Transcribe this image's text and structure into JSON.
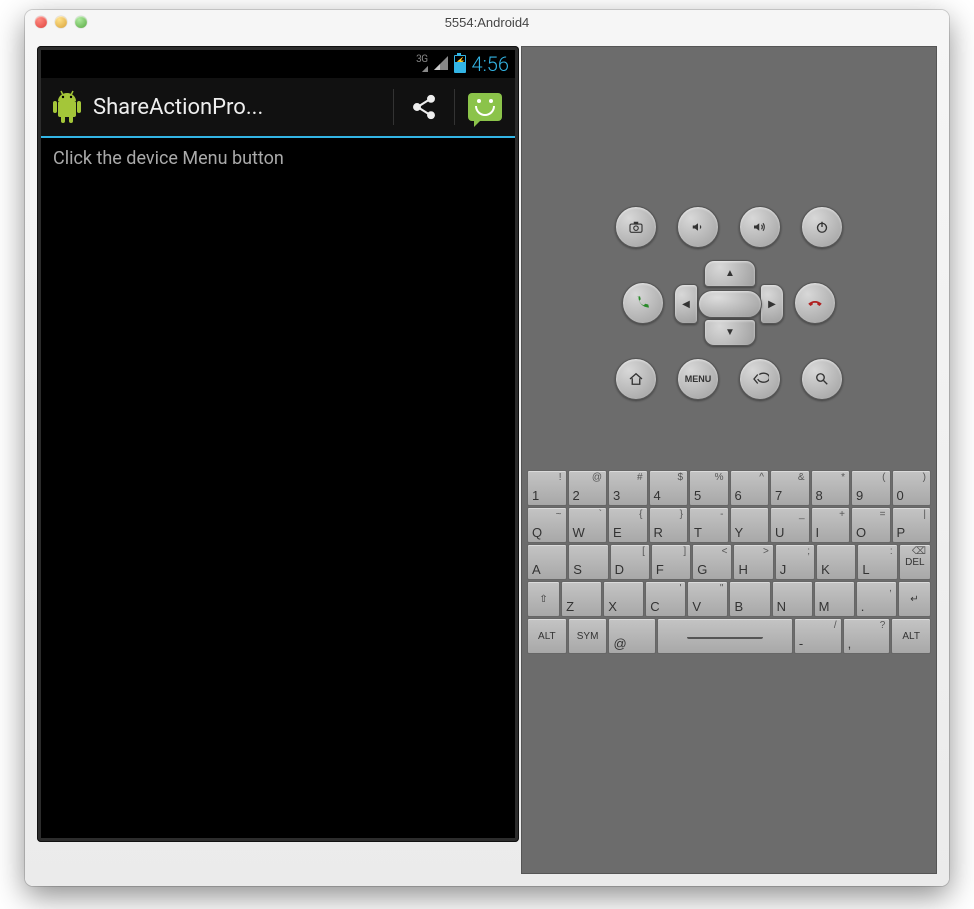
{
  "window": {
    "title": "5554:Android4"
  },
  "screen": {
    "status": {
      "network": "3G",
      "clock": "4:56"
    },
    "action_bar": {
      "app_title": "ShareActionPro..."
    },
    "body_text": "Click the device Menu button"
  },
  "controls": {
    "row1": [
      "camera",
      "volume-down",
      "volume-up",
      "power"
    ],
    "row2_left": "call",
    "row2_right": "end-call",
    "row3_labels": {
      "home": "",
      "menu": "MENU",
      "back": "",
      "search": ""
    }
  },
  "keyboard": {
    "rows": [
      [
        {
          "main": "1",
          "alt": "!"
        },
        {
          "main": "2",
          "alt": "@"
        },
        {
          "main": "3",
          "alt": "#"
        },
        {
          "main": "4",
          "alt": "$"
        },
        {
          "main": "5",
          "alt": "%"
        },
        {
          "main": "6",
          "alt": "^"
        },
        {
          "main": "7",
          "alt": "&"
        },
        {
          "main": "8",
          "alt": "*"
        },
        {
          "main": "9",
          "alt": "("
        },
        {
          "main": "0",
          "alt": ")"
        }
      ],
      [
        {
          "main": "Q",
          "alt": "~"
        },
        {
          "main": "W",
          "alt": "`"
        },
        {
          "main": "E",
          "alt": "{"
        },
        {
          "main": "R",
          "alt": "}"
        },
        {
          "main": "T",
          "alt": "-"
        },
        {
          "main": "Y",
          "alt": ""
        },
        {
          "main": "U",
          "alt": "_"
        },
        {
          "main": "I",
          "alt": "+"
        },
        {
          "main": "O",
          "alt": "="
        },
        {
          "main": "P",
          "alt": "|"
        }
      ],
      [
        {
          "main": "A",
          "alt": ""
        },
        {
          "main": "S",
          "alt": ""
        },
        {
          "main": "D",
          "alt": "["
        },
        {
          "main": "F",
          "alt": "]"
        },
        {
          "main": "G",
          "alt": "<"
        },
        {
          "main": "H",
          "alt": ">"
        },
        {
          "main": "J",
          "alt": ";"
        },
        {
          "main": "K",
          "alt": ""
        },
        {
          "main": "L",
          "alt": ":"
        },
        {
          "main": "DEL",
          "alt": "⌫",
          "fn": true
        }
      ],
      [
        {
          "main": "⇧",
          "fn": true
        },
        {
          "main": "Z",
          "alt": ""
        },
        {
          "main": "X",
          "alt": ""
        },
        {
          "main": "C",
          "alt": "'"
        },
        {
          "main": "V",
          "alt": "\""
        },
        {
          "main": "B",
          "alt": ""
        },
        {
          "main": "N",
          "alt": ""
        },
        {
          "main": "M",
          "alt": ""
        },
        {
          "main": ".",
          "alt": ","
        },
        {
          "main": "↵",
          "fn": true
        }
      ],
      [
        {
          "main": "ALT",
          "fn": true,
          "wide": true
        },
        {
          "main": "SYM",
          "fn": true,
          "wide": true
        },
        {
          "main": "@",
          "wide": true
        },
        {
          "main": "",
          "space": true
        },
        {
          "main": "-",
          "alt": "/",
          "wide": true
        },
        {
          "main": ",",
          "alt": "?",
          "wide": true
        },
        {
          "main": "ALT",
          "fn": true,
          "wide": true
        }
      ]
    ]
  }
}
